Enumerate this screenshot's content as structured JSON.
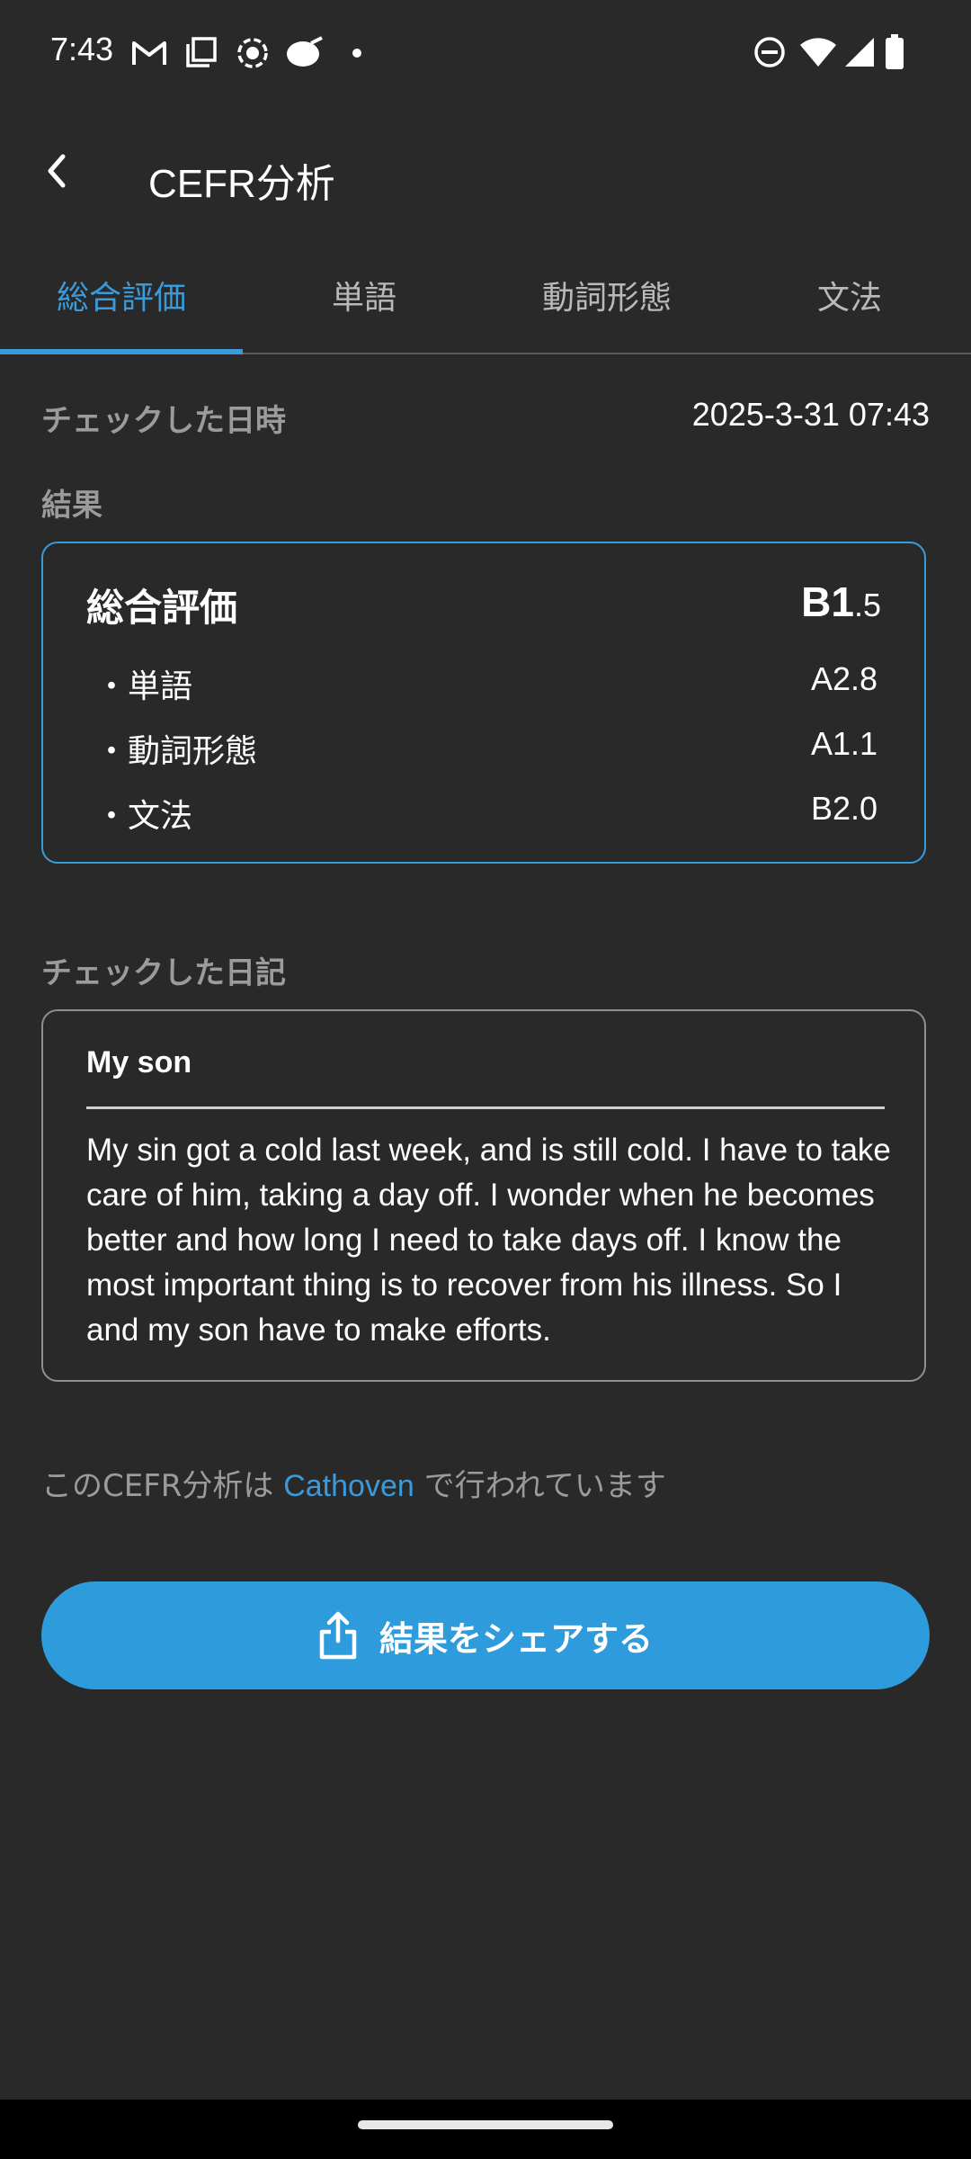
{
  "status_bar": {
    "time": "7:43",
    "icons_left": [
      "gmail-icon",
      "screenshot-icon",
      "record-icon",
      "app-icon",
      "dot-icon"
    ],
    "icons_right": [
      "dnd-icon",
      "wifi-icon",
      "signal-icon",
      "battery-icon"
    ]
  },
  "app_bar": {
    "title": "CEFR分析",
    "back_icon": "back-arrow-icon"
  },
  "tabs": [
    {
      "label": "総合評価",
      "active": true
    },
    {
      "label": "単語",
      "active": false
    },
    {
      "label": "動詞形態",
      "active": false
    },
    {
      "label": "文法",
      "active": false
    }
  ],
  "checked_at": {
    "label": "チェックした日時",
    "value": "2025-3-31 07:43"
  },
  "result": {
    "section_label": "結果",
    "overall_label": "総合評価",
    "overall_main": "B1",
    "overall_decimal": ".5",
    "items": [
      {
        "name": "・単語",
        "value": "A2.8"
      },
      {
        "name": "・動詞形態",
        "value": "A1.1"
      },
      {
        "name": "・文法",
        "value": "B2.0"
      }
    ]
  },
  "diary": {
    "section_label": "チェックした日記",
    "title": "My son",
    "body": "My sin got a cold last week, and is still cold. I have to take care of him, taking a day off. I wonder when he becomes better and how long I need to take days off. I know the most important thing is to recover from his illness. So I and my son have to make efforts."
  },
  "credit": {
    "prefix": "このCEFR分析は ",
    "link": "Cathoven",
    "suffix": " で行われています"
  },
  "share_button": {
    "label": "結果をシェアする",
    "icon": "share-icon"
  },
  "colors": {
    "background": "#292929",
    "accent": "#3a9bdc",
    "button": "#2e9bdc",
    "muted_text": "#9b9b9b"
  }
}
